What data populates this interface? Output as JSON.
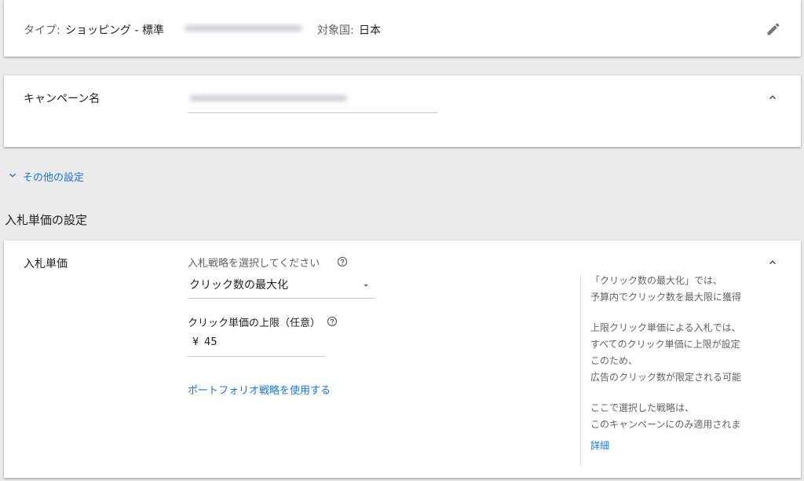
{
  "summary": {
    "type_label": "タイプ:",
    "type_value": "ショッピング - 標準",
    "country_label": "対象国:",
    "country_value": "日本"
  },
  "campaign_name": {
    "label": "キャンペーン名"
  },
  "more_settings": {
    "label": "その他の設定"
  },
  "bidding_section": {
    "title": "入札単価の設定"
  },
  "bidding": {
    "label": "入札単価",
    "strategy_prompt": "入札戦略を選択してください",
    "strategy_value": "クリック数の最大化",
    "max_cpc_label": "クリック単価の上限（任意）",
    "currency": "¥",
    "max_cpc_value": "45",
    "portfolio_link": "ポートフォリオ戦略を使用する"
  },
  "side_help": {
    "p1_l1": "「クリック数の最大化」では、",
    "p1_l2": "予算内でクリック数を最大限に獲得",
    "p2_l1": "上限クリック単価による入札では、",
    "p2_l2": "すべてのクリック単価に上限が設定",
    "p2_l3": "このため、",
    "p2_l4": "広告のクリック数が限定される可能",
    "p3_l1": "ここで選択した戦略は、",
    "p3_l2": "このキャンペーンにのみ適用されま",
    "details_link": "詳細"
  }
}
